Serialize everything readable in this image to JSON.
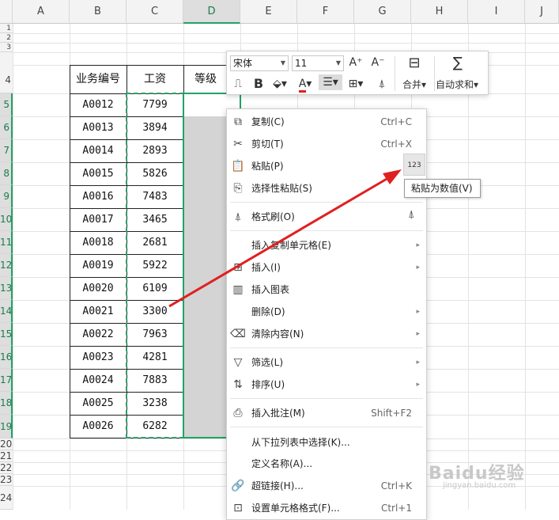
{
  "columns": [
    "A",
    "B",
    "C",
    "D",
    "E",
    "F",
    "G",
    "H",
    "I",
    "J"
  ],
  "selected_column": "D",
  "row_numbers": [
    "1",
    "2",
    "3",
    "4",
    "5",
    "6",
    "7",
    "8",
    "9",
    "10",
    "11",
    "12",
    "13",
    "14",
    "15",
    "16",
    "17",
    "18",
    "19",
    "20",
    "21",
    "22",
    "23",
    "24"
  ],
  "table": {
    "headers": [
      "业务编号",
      "工资",
      "等级"
    ],
    "rows": [
      [
        "A0012",
        "7799"
      ],
      [
        "A0013",
        "3894"
      ],
      [
        "A0014",
        "2893"
      ],
      [
        "A0015",
        "5826"
      ],
      [
        "A0016",
        "7483"
      ],
      [
        "A0017",
        "3465"
      ],
      [
        "A0018",
        "2681"
      ],
      [
        "A0019",
        "5922"
      ],
      [
        "A0020",
        "6109"
      ],
      [
        "A0021",
        "3300"
      ],
      [
        "A0022",
        "7963"
      ],
      [
        "A0023",
        "4281"
      ],
      [
        "A0024",
        "7883"
      ],
      [
        "A0025",
        "3238"
      ],
      [
        "A0026",
        "6282"
      ]
    ]
  },
  "toolbar": {
    "font": "宋体",
    "size": "11",
    "grow_font": "A⁺",
    "shrink_font": "A⁻",
    "merge_label": "合并",
    "autosum_label": "自动求和"
  },
  "menu": {
    "copy": {
      "label": "复制(C)",
      "shortcut": "Ctrl+C"
    },
    "cut": {
      "label": "剪切(T)",
      "shortcut": "Ctrl+X"
    },
    "paste": {
      "label": "粘贴(P)"
    },
    "paste_special": {
      "label": "选择性粘贴(S)"
    },
    "format_painter": {
      "label": "格式刷(O)"
    },
    "insert_copied": {
      "label": "插入复制单元格(E)"
    },
    "insert": {
      "label": "插入(I)"
    },
    "insert_chart": {
      "label": "插入图表"
    },
    "delete": {
      "label": "删除(D)"
    },
    "clear": {
      "label": "清除内容(N)"
    },
    "filter": {
      "label": "筛选(L)"
    },
    "sort": {
      "label": "排序(U)"
    },
    "insert_comment": {
      "label": "插入批注(M)",
      "shortcut": "Shift+F2"
    },
    "pick_list": {
      "label": "从下拉列表中选择(K)..."
    },
    "define_name": {
      "label": "定义名称(A)..."
    },
    "hyperlink": {
      "label": "超链接(H)...",
      "shortcut": "Ctrl+K"
    },
    "format_cells": {
      "label": "设置单元格格式(F)...",
      "shortcut": "Ctrl+1"
    }
  },
  "paste_values_tooltip": "粘贴为数值(V)",
  "paste_values_icon_text": "123",
  "watermark": {
    "brand": "Baidu经验",
    "sub": "jingyan.baidu.com"
  },
  "colors": {
    "accent": "#21a366",
    "arrow": "#e02020",
    "selection_fill": "#d4d4d4"
  }
}
